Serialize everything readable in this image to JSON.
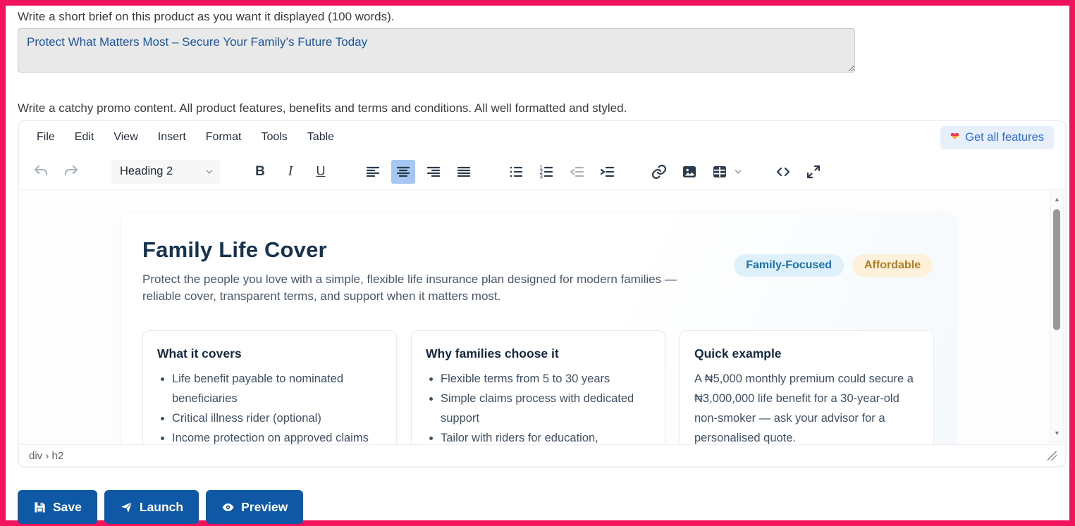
{
  "colors": {
    "frame_border": "#f1135c",
    "primary_button_blue": "#0e58a5",
    "toolbar_active_bg": "#a6c7f2",
    "features_button_bg": "#e7f0fa",
    "features_button_text": "#2f6bd5",
    "badge_blue_bg": "#def1fb",
    "badge_blue_text": "#1d6fa9",
    "badge_amber_bg": "#fdf1db",
    "badge_amber_text": "#b07c22",
    "brief_text_blue": "#19559c"
  },
  "brief": {
    "label": "Write a short brief on this product as you want it displayed (100 words).",
    "value": "Protect What Matters Most – Secure Your Family’s Future Today"
  },
  "promo": {
    "label": "Write a catchy promo content. All product features, benefits and terms and conditions. All well formatted and styled."
  },
  "editor": {
    "menu": [
      "File",
      "Edit",
      "View",
      "Insert",
      "Format",
      "Tools",
      "Table"
    ],
    "get_all_features": "Get all features",
    "toolbar": {
      "format_select": "Heading 2",
      "bold": "B",
      "italic": "I",
      "underline": "U"
    },
    "status_path": "div › h2"
  },
  "doc": {
    "title": "Family Life Cover",
    "subtitle": "Protect the people you love with a simple, flexible life insurance plan designed for modern families — reliable cover, transparent terms, and support when it matters most.",
    "badges": [
      {
        "label": "Family-Focused"
      },
      {
        "label": "Affordable"
      }
    ],
    "cards": [
      {
        "title": "What it covers",
        "bullets": [
          "Life benefit payable to nominated beneficiaries",
          "Critical illness rider (optional)",
          "Income protection on approved claims"
        ]
      },
      {
        "title": "Why families choose it",
        "bullets": [
          "Flexible terms from 5 to 30 years",
          "Simple claims process with dedicated support",
          "Tailor with riders for education,"
        ]
      },
      {
        "title": "Quick example",
        "text": "A ₦5,000 monthly premium could secure a ₦3,000,000 life benefit for a 30-year-old non-smoker — ask your advisor for a personalised quote."
      }
    ]
  },
  "actions": [
    {
      "label": "Save"
    },
    {
      "label": "Launch"
    },
    {
      "label": "Preview"
    }
  ],
  "icons": {
    "heart": "❤",
    "scroll_up": "▲",
    "scroll_down": "▼"
  }
}
